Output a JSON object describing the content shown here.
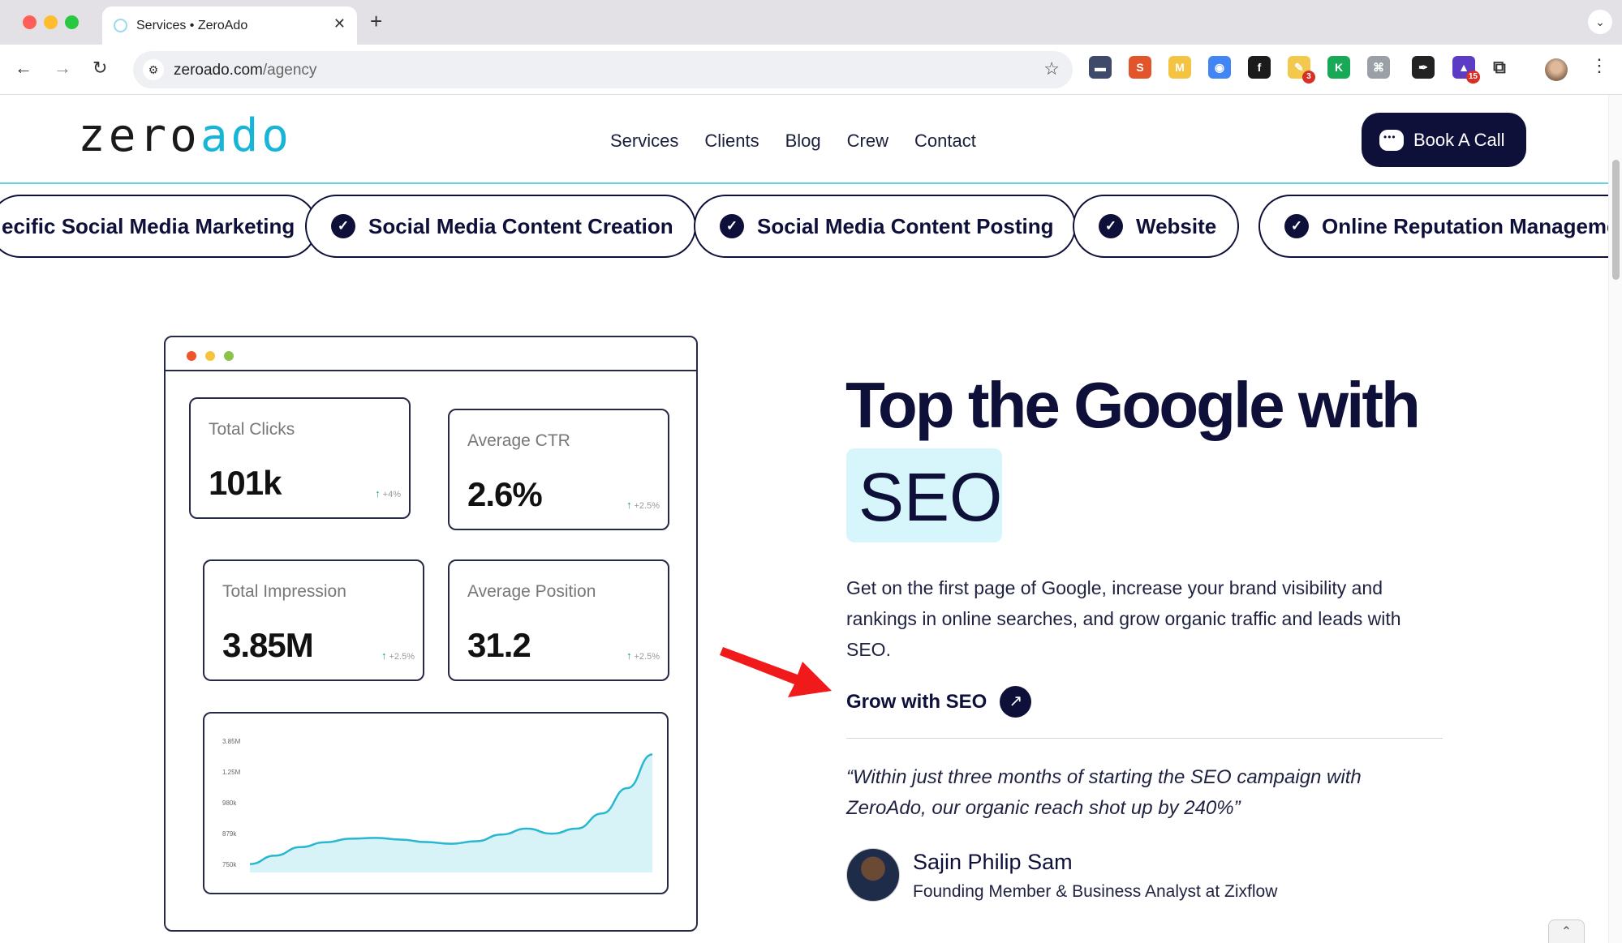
{
  "browser": {
    "tab_title": "Services • ZeroAdo",
    "url_host": "zeroado.com",
    "url_path": "/agency",
    "extensions": [
      {
        "name": "folder-extension",
        "bg": "#3f4a6b",
        "glyph": "▬",
        "badge": ""
      },
      {
        "name": "s-extension",
        "bg": "#e2552b",
        "glyph": "S",
        "badge": ""
      },
      {
        "name": "m-extension",
        "bg": "#f5c342",
        "glyph": "M",
        "badge": ""
      },
      {
        "name": "chrome-color-extension",
        "bg": "#4285f4",
        "glyph": "◉",
        "badge": ""
      },
      {
        "name": "font-extension",
        "bg": "#1b1b1b",
        "glyph": "f",
        "badge": ""
      },
      {
        "name": "notes-extension",
        "bg": "#f2c94c",
        "glyph": "✎",
        "badge": "3"
      },
      {
        "name": "k-extension",
        "bg": "#18a957",
        "glyph": "K",
        "badge": ""
      },
      {
        "name": "gray-extension",
        "bg": "#9aa0a6",
        "glyph": "⌘",
        "badge": ""
      },
      {
        "name": "dropper-extension",
        "bg": "#222222",
        "glyph": "✒",
        "badge": ""
      },
      {
        "name": "cap-extension",
        "bg": "#5b3cc4",
        "glyph": "▲",
        "badge": "15"
      }
    ]
  },
  "header": {
    "logo_zero": "zero",
    "logo_ado": "ado",
    "nav": [
      "Services",
      "Clients",
      "Blog",
      "Crew",
      "Contact"
    ],
    "cta": "Book A Call"
  },
  "pills": [
    "ecific Social Media Marketing",
    "Social Media Content Creation",
    "Social Media Content Posting",
    "Website",
    "Online Reputation Managemen"
  ],
  "dashboard": {
    "cards": [
      {
        "label": "Total Clicks",
        "value": "101k",
        "delta": "+4%"
      },
      {
        "label": "Average CTR",
        "value": "2.6%",
        "delta": "+2.5%"
      },
      {
        "label": "Total Impression",
        "value": "3.85M",
        "delta": "+2.5%"
      },
      {
        "label": "Average Position",
        "value": "31.2",
        "delta": "+2.5%"
      }
    ]
  },
  "chart_data": {
    "type": "area",
    "title": "",
    "xlabel": "",
    "ylabel": "",
    "y_tick_labels": [
      "3.85M",
      "1.25M",
      "980k",
      "879k",
      "750k"
    ],
    "series": [
      {
        "values": [
          750000,
          800000,
          850000,
          879000,
          900000,
          905000,
          895000,
          880000,
          870000,
          885000,
          925000,
          960000,
          930000,
          960000,
          1050000,
          1200000,
          1400000
        ]
      }
    ],
    "color": "#27b7cf",
    "fill": "#d8f3f8",
    "grid": false
  },
  "hero": {
    "title": "Top the Google with",
    "highlight": "SEO",
    "description": "Get on the first page of Google, increase your brand visibility and rankings in online searches, and grow organic traffic and leads with SEO.",
    "cta": "Grow with SEO"
  },
  "testimonial": {
    "quote": "“Within just three months of starting the SEO campaign with ZeroAdo, our organic reach shot up by 240%”",
    "name": "Sajin Philip Sam",
    "role": "Founding Member & Business Analyst at Zixflow"
  }
}
